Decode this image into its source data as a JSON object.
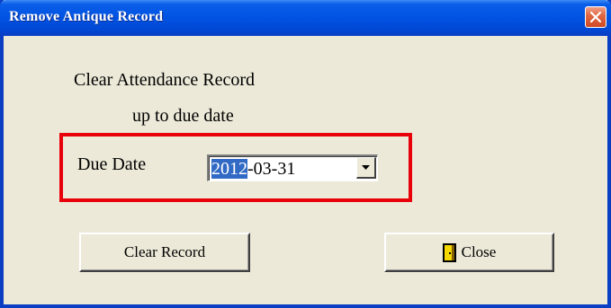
{
  "window": {
    "title": "Remove Antique Record"
  },
  "content": {
    "heading_line1": "Clear Attendance Record",
    "heading_line2": "up to due date",
    "due_date_label": "Due Date",
    "due_date": {
      "selected_part": "2012",
      "rest": "-03-31"
    }
  },
  "buttons": {
    "clear_label": "Clear Record",
    "close_label": "Close"
  },
  "colors": {
    "highlight_border": "#e8000b",
    "title_bar": "#0254e3",
    "selection": "#316ac5"
  }
}
